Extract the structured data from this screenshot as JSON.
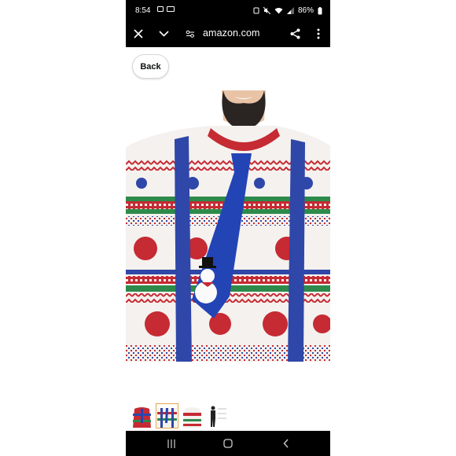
{
  "status_bar": {
    "time": "8:54",
    "battery": "86%",
    "left_icons": [
      "image-icon",
      "sim-icon"
    ],
    "right_icons": [
      "alarm-icon",
      "mute-icon",
      "wifi-icon",
      "signal-icon",
      "battery-icon"
    ]
  },
  "browser": {
    "url": "amazon.com",
    "close_icon": "close-icon",
    "collapse_icon": "chevron-down-icon",
    "site_settings_icon": "tune-icon",
    "share_icon": "share-icon",
    "menu_icon": "more-vert-icon"
  },
  "page": {
    "back_label": "Back"
  },
  "product": {
    "image_alt": "Ugly Christmas sweater with blue snowman tie and suspenders",
    "thumbnails": [
      {
        "icon": "sweater-front-thumb",
        "selected": false
      },
      {
        "icon": "sweater-closeup-thumb",
        "selected": true
      },
      {
        "icon": "sweater-back-thumb",
        "selected": false
      },
      {
        "icon": "size-chart-thumb",
        "selected": false
      }
    ]
  },
  "nav": {
    "recents_icon": "recents-icon",
    "home_icon": "home-icon",
    "back_icon": "back-icon"
  },
  "colors": {
    "sweater_red": "#c62a33",
    "sweater_green": "#2d8a4b",
    "sweater_blue": "#2f47a8",
    "tie_blue": "#2344b5",
    "selected_border": "#e3a44a"
  }
}
